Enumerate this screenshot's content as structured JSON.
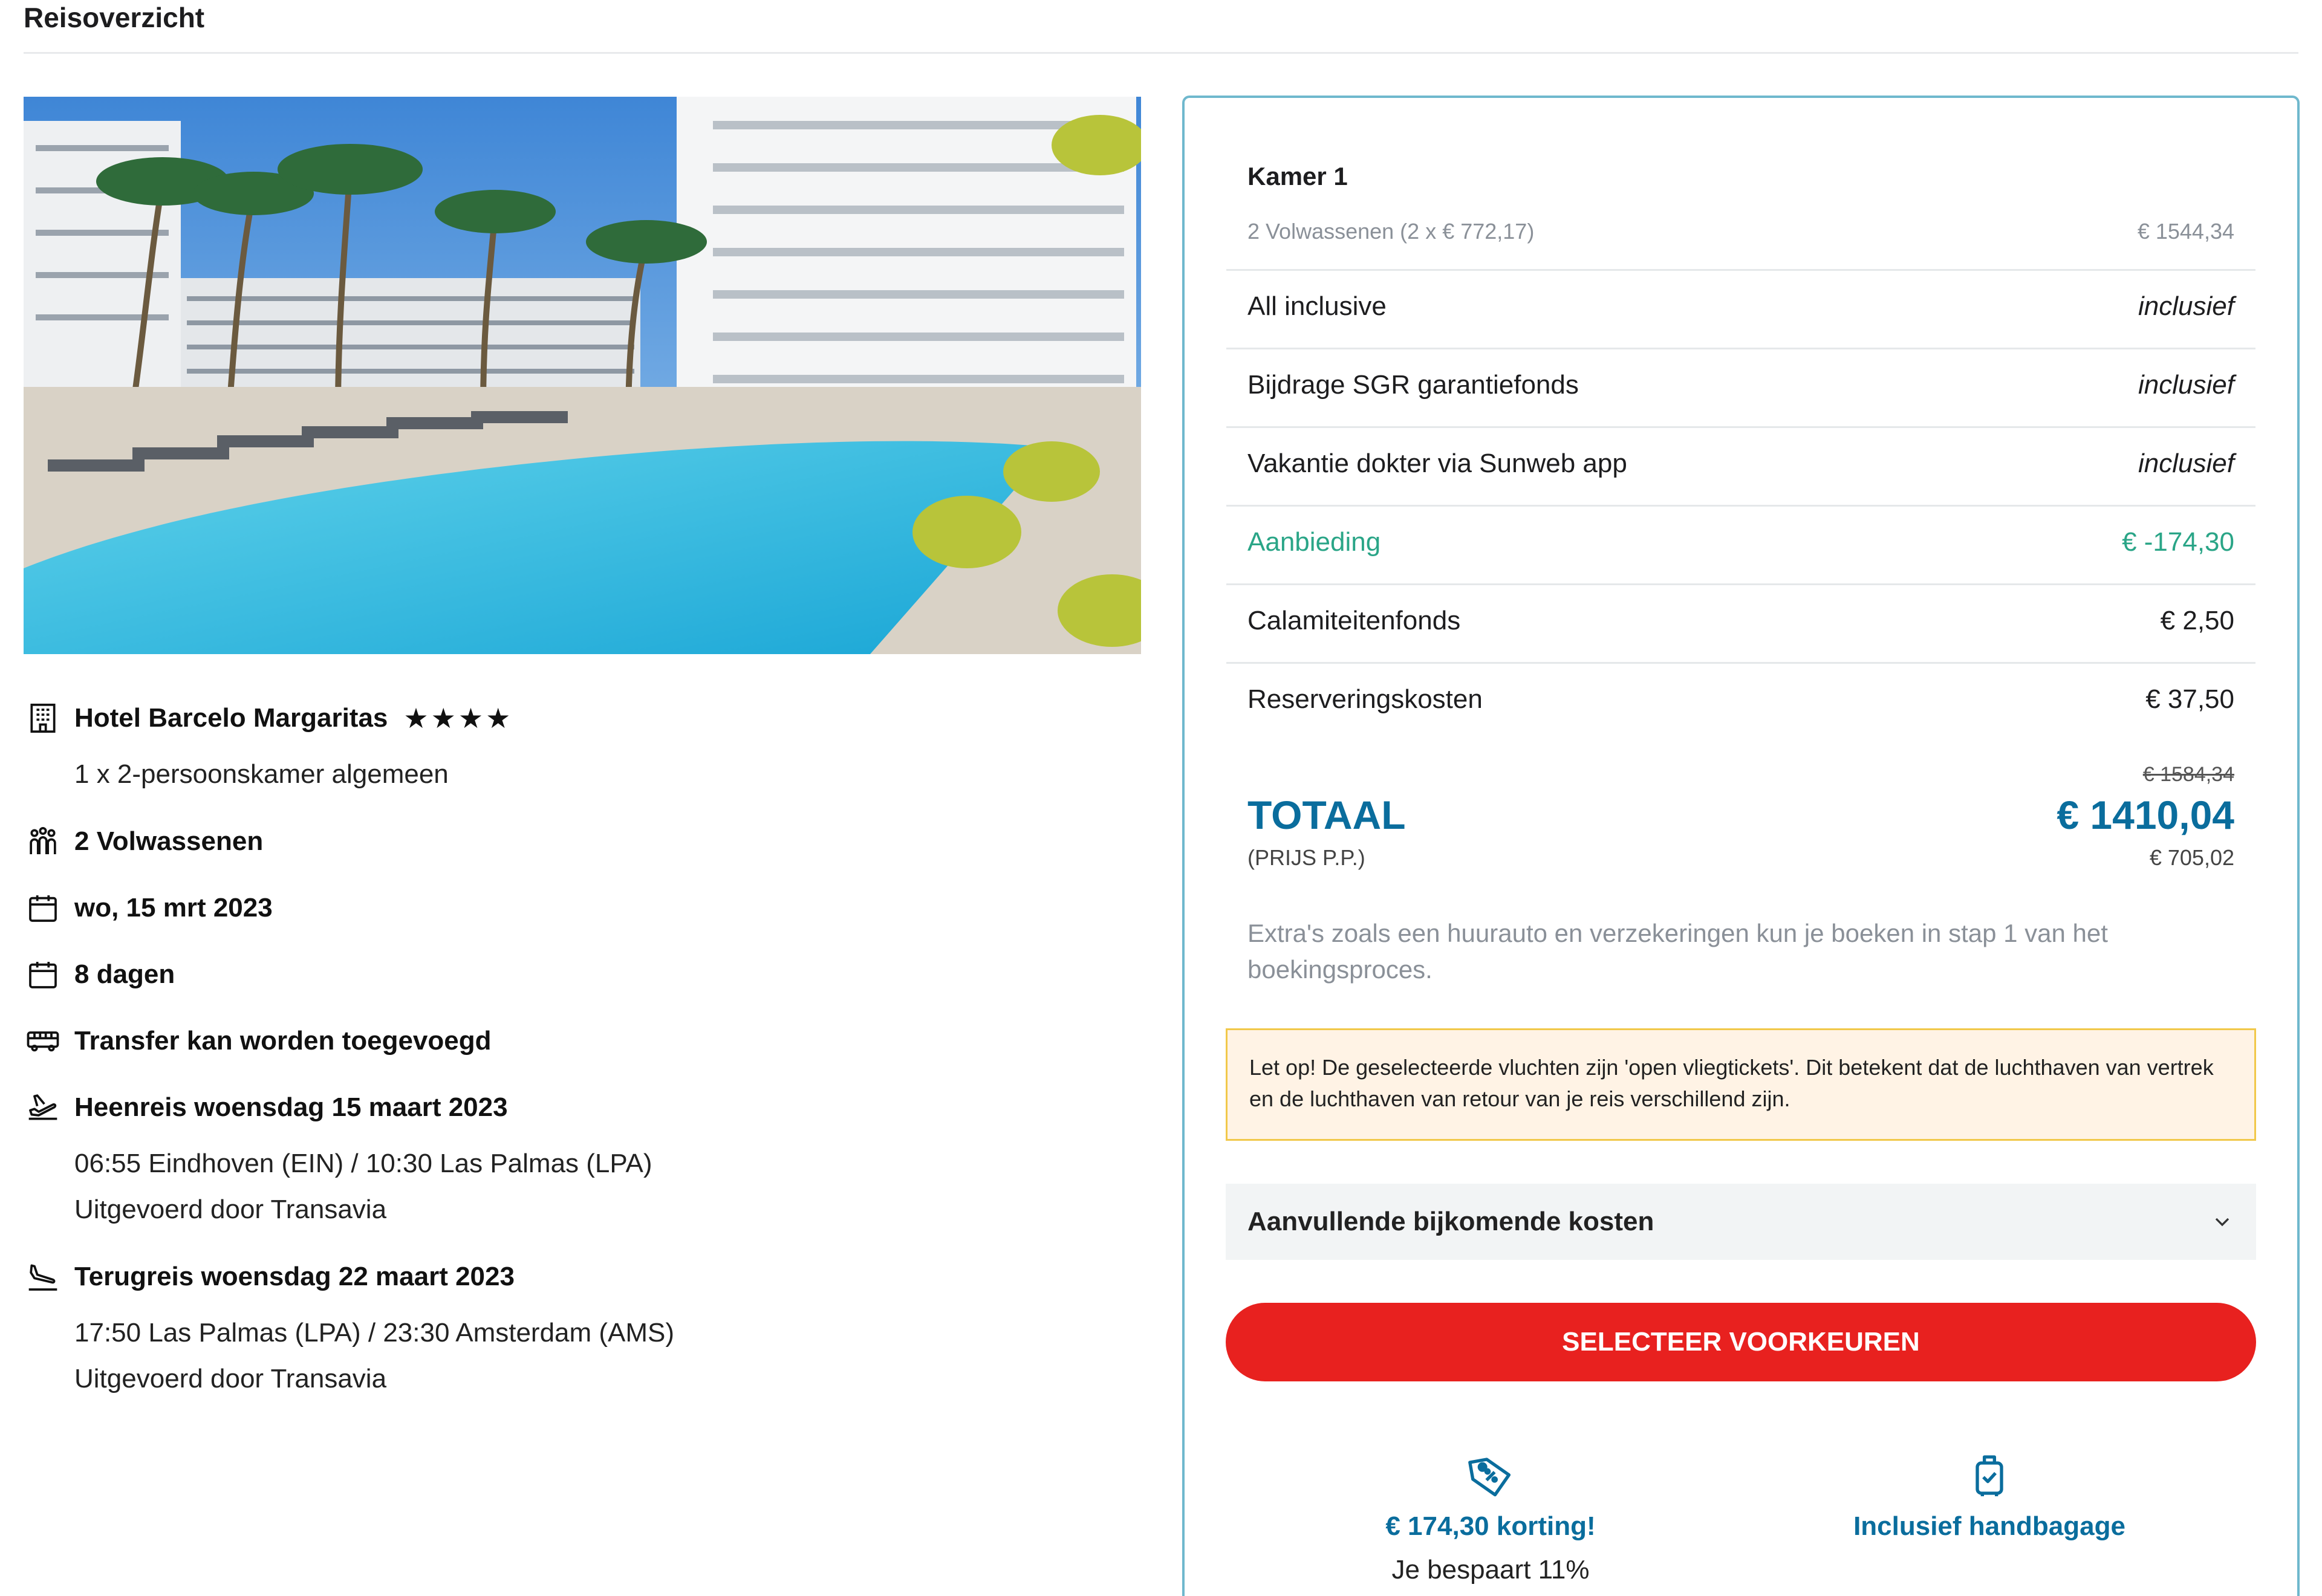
{
  "header": {
    "title": "Reisoverzicht"
  },
  "hotel": {
    "name": "Hotel Barcelo Margaritas",
    "stars": "★★★★",
    "star_count": 4,
    "room": "1 x 2-persoonskamer algemeen"
  },
  "trip": {
    "travellers": "2 Volwassenen",
    "date": "wo, 15 mrt 2023",
    "duration": "8 dagen",
    "transfer": "Transfer kan worden toegevoegd",
    "outbound": {
      "title": "Heenreis woensdag 15 maart 2023",
      "route": "06:55 Eindhoven (EIN) / 10:30 Las Palmas (LPA)",
      "carrier": "Uitgevoerd door Transavia"
    },
    "return": {
      "title": "Terugreis woensdag 22 maart 2023",
      "route": "17:50 Las Palmas (LPA) / 23:30 Amsterdam (AMS)",
      "carrier": "Uitgevoerd door Transavia"
    }
  },
  "summary": {
    "room_title": "Kamer 1",
    "lines": [
      {
        "label": "2 Volwassenen (2 x € 772,17)",
        "value": "€ 1544,34"
      },
      {
        "label": "All inclusive",
        "value": "inclusief"
      },
      {
        "label": "Bijdrage SGR garantiefonds",
        "value": "inclusief"
      },
      {
        "label": "Vakantie dokter via Sunweb app",
        "value": "inclusief"
      },
      {
        "label": "Aanbieding",
        "value": "€ -174,30"
      },
      {
        "label": "Calamiteitenfonds",
        "value": "€ 2,50"
      },
      {
        "label": "Reserveringskosten",
        "value": "€ 37,50"
      }
    ],
    "total_label": "TOTAAL",
    "total_sub": "(PRIJS P.P.)",
    "total_old": "€ 1584,34",
    "total_new": "€ 1410,04",
    "total_pp": "€ 705,02",
    "extras_note": "Extra's zoals een huurauto en verzekeringen kun je boeken in stap 1 van het boekingsproces.",
    "warning": "Let op! De geselecteerde vluchten zijn 'open vliegtickets'. Dit betekent dat de luchthaven van vertrek en de luchthaven van retour van je reis verschillend zijn.",
    "accordion_label": "Aanvullende bijkomende kosten",
    "cta_label": "SELECTEER VOORKEUREN"
  },
  "perks": {
    "discount_title": "€ 174,30 korting!",
    "discount_sub": "Je bespaart 11%",
    "baggage_title": "Inclusief handbagage"
  },
  "colors": {
    "accent_blue": "#0a6d9d",
    "discount_green": "#2aa587",
    "cta_red": "#e8211f",
    "panel_border": "#6fb8cd",
    "warning_bg": "#fff3e5",
    "warning_border": "#f1c84a"
  },
  "icons": [
    "building-icon",
    "people-icon",
    "calendar-icon",
    "bus-icon",
    "plane-takeoff-icon",
    "plane-landing-icon",
    "chevron-down-icon",
    "price-tag-icon",
    "luggage-check-icon"
  ]
}
